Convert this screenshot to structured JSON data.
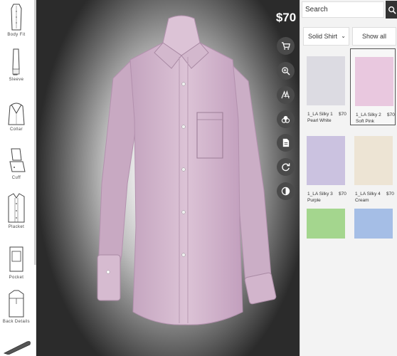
{
  "rail": {
    "items": [
      {
        "label": "Body Fit",
        "icon": "body-fit-icon"
      },
      {
        "label": "Sleeve",
        "icon": "sleeve-icon"
      },
      {
        "label": "Collar",
        "icon": "collar-icon"
      },
      {
        "label": "Cuff",
        "icon": "cuff-icon"
      },
      {
        "label": "Placket",
        "icon": "placket-icon"
      },
      {
        "label": "Pocket",
        "icon": "pocket-icon"
      },
      {
        "label": "Back Details",
        "icon": "back-details-icon"
      }
    ]
  },
  "stage": {
    "price": "$70",
    "shirt_color": "#d6b8cf",
    "tools": [
      "cart-icon",
      "zoom-in-icon",
      "monogram-icon",
      "contrast-fabric-icon",
      "document-icon",
      "rotate-icon",
      "contrast-toggle-icon"
    ]
  },
  "panel": {
    "search_placeholder": "Search",
    "category": "Solid Shirt",
    "show_all": "Show all",
    "fabrics": [
      {
        "name": "1_LA Silky 1 Pearl White",
        "price": "$70",
        "color": "#dcdbe2",
        "selected": false
      },
      {
        "name": "1_LA Silky 2 Soft Pink",
        "price": "$70",
        "color": "#e9c8df",
        "selected": true
      },
      {
        "name": "1_LA Silky 3 Purple",
        "price": "$70",
        "color": "#cbc2e0",
        "selected": false
      },
      {
        "name": "1_LA Silky 4 Cream",
        "price": "$70",
        "color": "#ede4d4",
        "selected": false
      },
      {
        "name": "",
        "price": "",
        "color": "#a4d68e",
        "selected": false
      },
      {
        "name": "",
        "price": "",
        "color": "#a5bee6",
        "selected": false
      }
    ]
  }
}
